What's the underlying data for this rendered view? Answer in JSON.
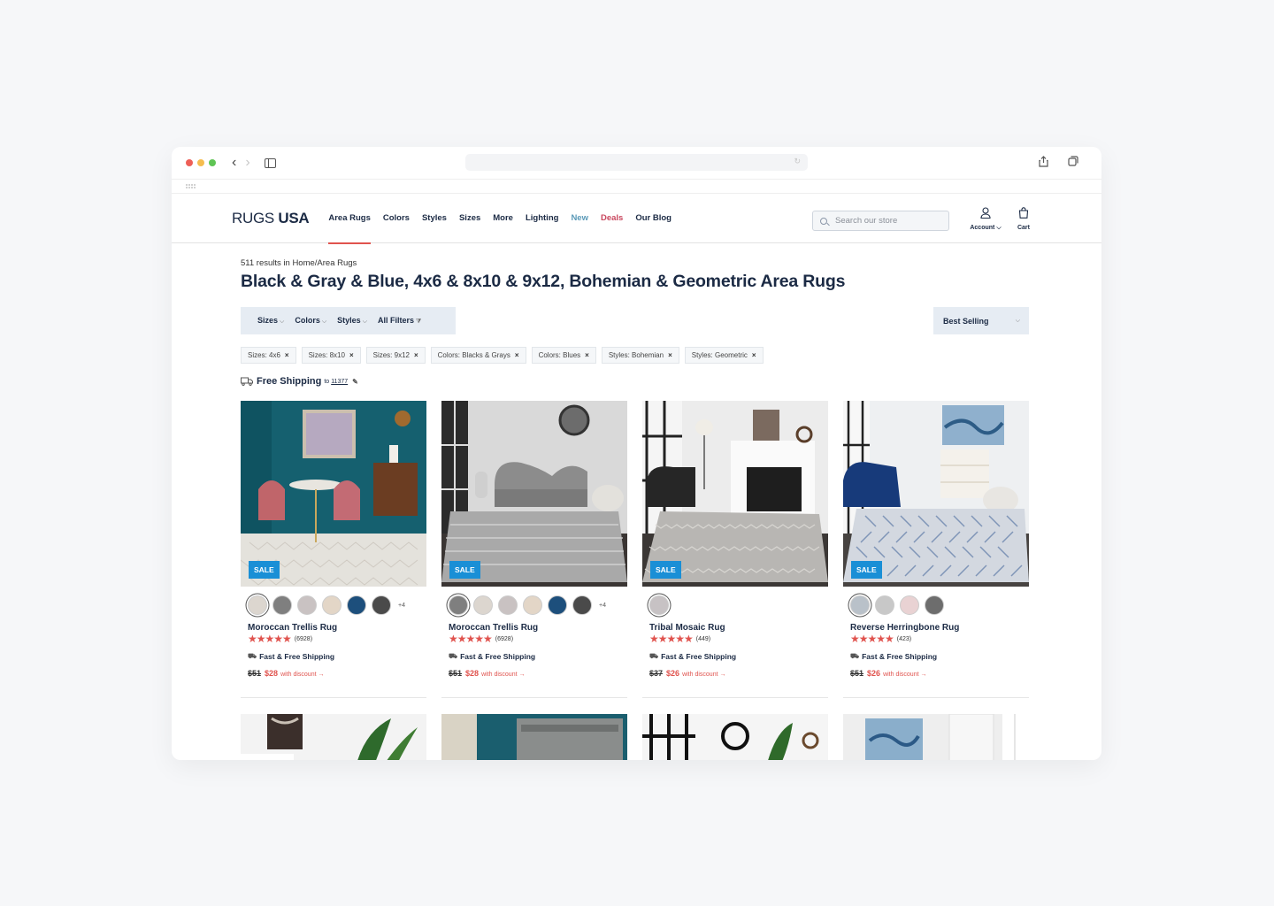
{
  "site": {
    "logo_light": "RUGS",
    "logo_bold": "USA",
    "menu": [
      "Area Rugs",
      "Colors",
      "Styles",
      "Sizes",
      "More",
      "Lighting",
      "New",
      "Deals",
      "Our Blog"
    ],
    "search_placeholder": "Search our store",
    "account_label": "Account",
    "cart_label": "Cart"
  },
  "listing": {
    "results_text": "511 results in Home/Area Rugs",
    "title": "Black & Gray & Blue, 4x6 & 8x10 & 9x12, Bohemian & Geometric Area Rugs",
    "filters": [
      "Sizes",
      "Colors",
      "Styles",
      "All Filters"
    ],
    "sort_label": "Best Selling",
    "chips": [
      "Sizes: 4x6",
      "Sizes: 8x10",
      "Sizes: 9x12",
      "Colors: Blacks & Grays",
      "Colors: Blues",
      "Styles: Bohemian",
      "Styles: Geometric"
    ],
    "free_shipping": "Free Shipping",
    "free_shipping_to": "to",
    "zip": "11377"
  },
  "products": [
    {
      "name": "Moroccan Trellis Rug",
      "count": "(6928)",
      "shipping": "Fast & Free Shipping",
      "old_price": "$51",
      "new_price": "$28",
      "discount_text": "with discount →",
      "sale": "SALE",
      "more": "+4",
      "swatches": [
        "#dcd6cf",
        "#7f7f7f",
        "#c9c2c2",
        "#e3d6c7",
        "#1d4f7c",
        "#4a4a4a"
      ],
      "selected": 0
    },
    {
      "name": "Moroccan Trellis Rug",
      "count": "(6928)",
      "shipping": "Fast & Free Shipping",
      "old_price": "$51",
      "new_price": "$28",
      "discount_text": "with discount →",
      "sale": "SALE",
      "more": "+4",
      "swatches": [
        "#7f7f7f",
        "#dcd6cf",
        "#c9c2c2",
        "#e3d6c7",
        "#1d4f7c",
        "#4a4a4a"
      ],
      "selected": 0
    },
    {
      "name": "Tribal Mosaic Rug",
      "count": "(449)",
      "shipping": "Fast & Free Shipping",
      "old_price": "$37",
      "new_price": "$26",
      "discount_text": "with discount →",
      "sale": "SALE",
      "more": "",
      "swatches": [
        "#c7c2c4"
      ],
      "selected": 0
    },
    {
      "name": "Reverse Herringbone Rug",
      "count": "(423)",
      "shipping": "Fast & Free Shipping",
      "old_price": "$51",
      "new_price": "$26",
      "discount_text": "with discount →",
      "sale": "SALE",
      "more": "",
      "swatches": [
        "#b9c1c9",
        "#c8c8c8",
        "#e9d2d3",
        "#6d6d6d"
      ],
      "selected": 0
    }
  ],
  "colors": {
    "accent_red": "#e0534e",
    "sale_blue": "#1a8fd6",
    "navy": "#1b2a44"
  }
}
